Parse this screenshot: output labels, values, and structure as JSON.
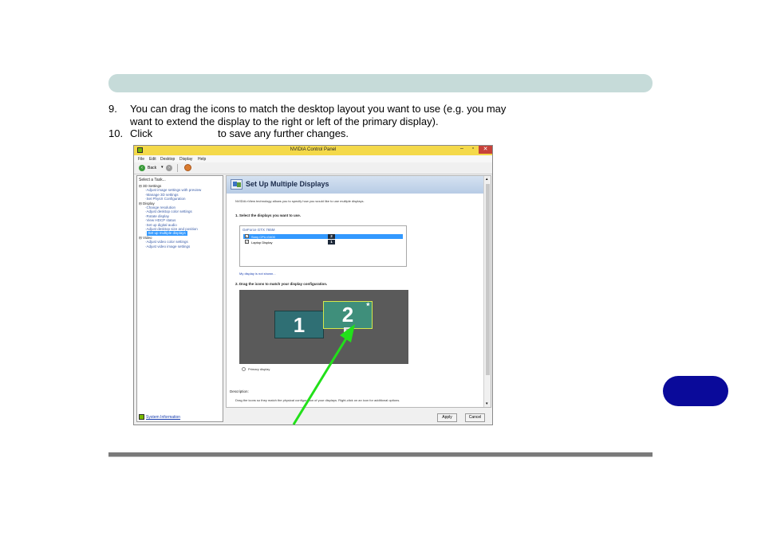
{
  "instructions": [
    {
      "number": "9.",
      "line1": "You can drag the icons to match the desktop layout you want to use (e.g. you may",
      "line2": "want to extend the display to the right or left of the primary display)."
    },
    {
      "number": "10.",
      "before": "Click",
      "after": "to save any further changes."
    }
  ],
  "window": {
    "title": "NVIDIA Control Panel",
    "controls": {
      "minimize": "–",
      "maximize": "▫",
      "close": "✕"
    },
    "menu": [
      "File",
      "Edit",
      "Desktop",
      "Display",
      "Help"
    ],
    "toolbar": {
      "back": "Back"
    },
    "task_panel": {
      "header": "Select a Task...",
      "tree": [
        {
          "label": "3D Settings",
          "level": 0
        },
        {
          "label": "Adjust image settings with preview",
          "level": 1
        },
        {
          "label": "Manage 3D settings",
          "level": 1
        },
        {
          "label": "Set PhysX Configuration",
          "level": 1
        },
        {
          "label": "Display",
          "level": 0
        },
        {
          "label": "Change resolution",
          "level": 1
        },
        {
          "label": "Adjust desktop color settings",
          "level": 1
        },
        {
          "label": "Rotate display",
          "level": 1
        },
        {
          "label": "View HDCP status",
          "level": 1
        },
        {
          "label": "Set up digital audio",
          "level": 1
        },
        {
          "label": "Adjust desktop size and position",
          "level": 1
        },
        {
          "label": "Set up multiple displays",
          "level": 1,
          "selected": true
        },
        {
          "label": "Video",
          "level": 0
        },
        {
          "label": "Adjust video color settings",
          "level": 1
        },
        {
          "label": "Adjust video image settings",
          "level": 1
        }
      ],
      "system_info": "System Information"
    },
    "page": {
      "title": "Set Up Multiple Displays",
      "intro": "NVIDIA nView technology allows you to specify how you would like to use multiple displays.",
      "section1": "1. Select the displays you want to use.",
      "gpu": "GeForce GTX 765M",
      "displays": [
        {
          "name": "Sony CPU-G400",
          "checked": true,
          "badge": "2",
          "selected": true
        },
        {
          "name": "Laptop Display",
          "checked": true,
          "badge": "1",
          "selected": false
        }
      ],
      "not_shown_link": "My display is not shown...",
      "section2": "2. Drag the icons to match your display configuration.",
      "monitor1": "1",
      "monitor2": "2",
      "primary_label": "Primary display",
      "description_header": "Description:",
      "description": "Drag the icons so they match the physical configuration of your displays. Right-click on an icon for additional options."
    },
    "buttons": {
      "apply": "Apply",
      "cancel": "Cancel"
    }
  },
  "colors": {
    "header_band": "#c6dbd9",
    "side_tab": "#0a0a9a",
    "arrow": "#22e01a",
    "titlebar": "#f4d94a"
  }
}
